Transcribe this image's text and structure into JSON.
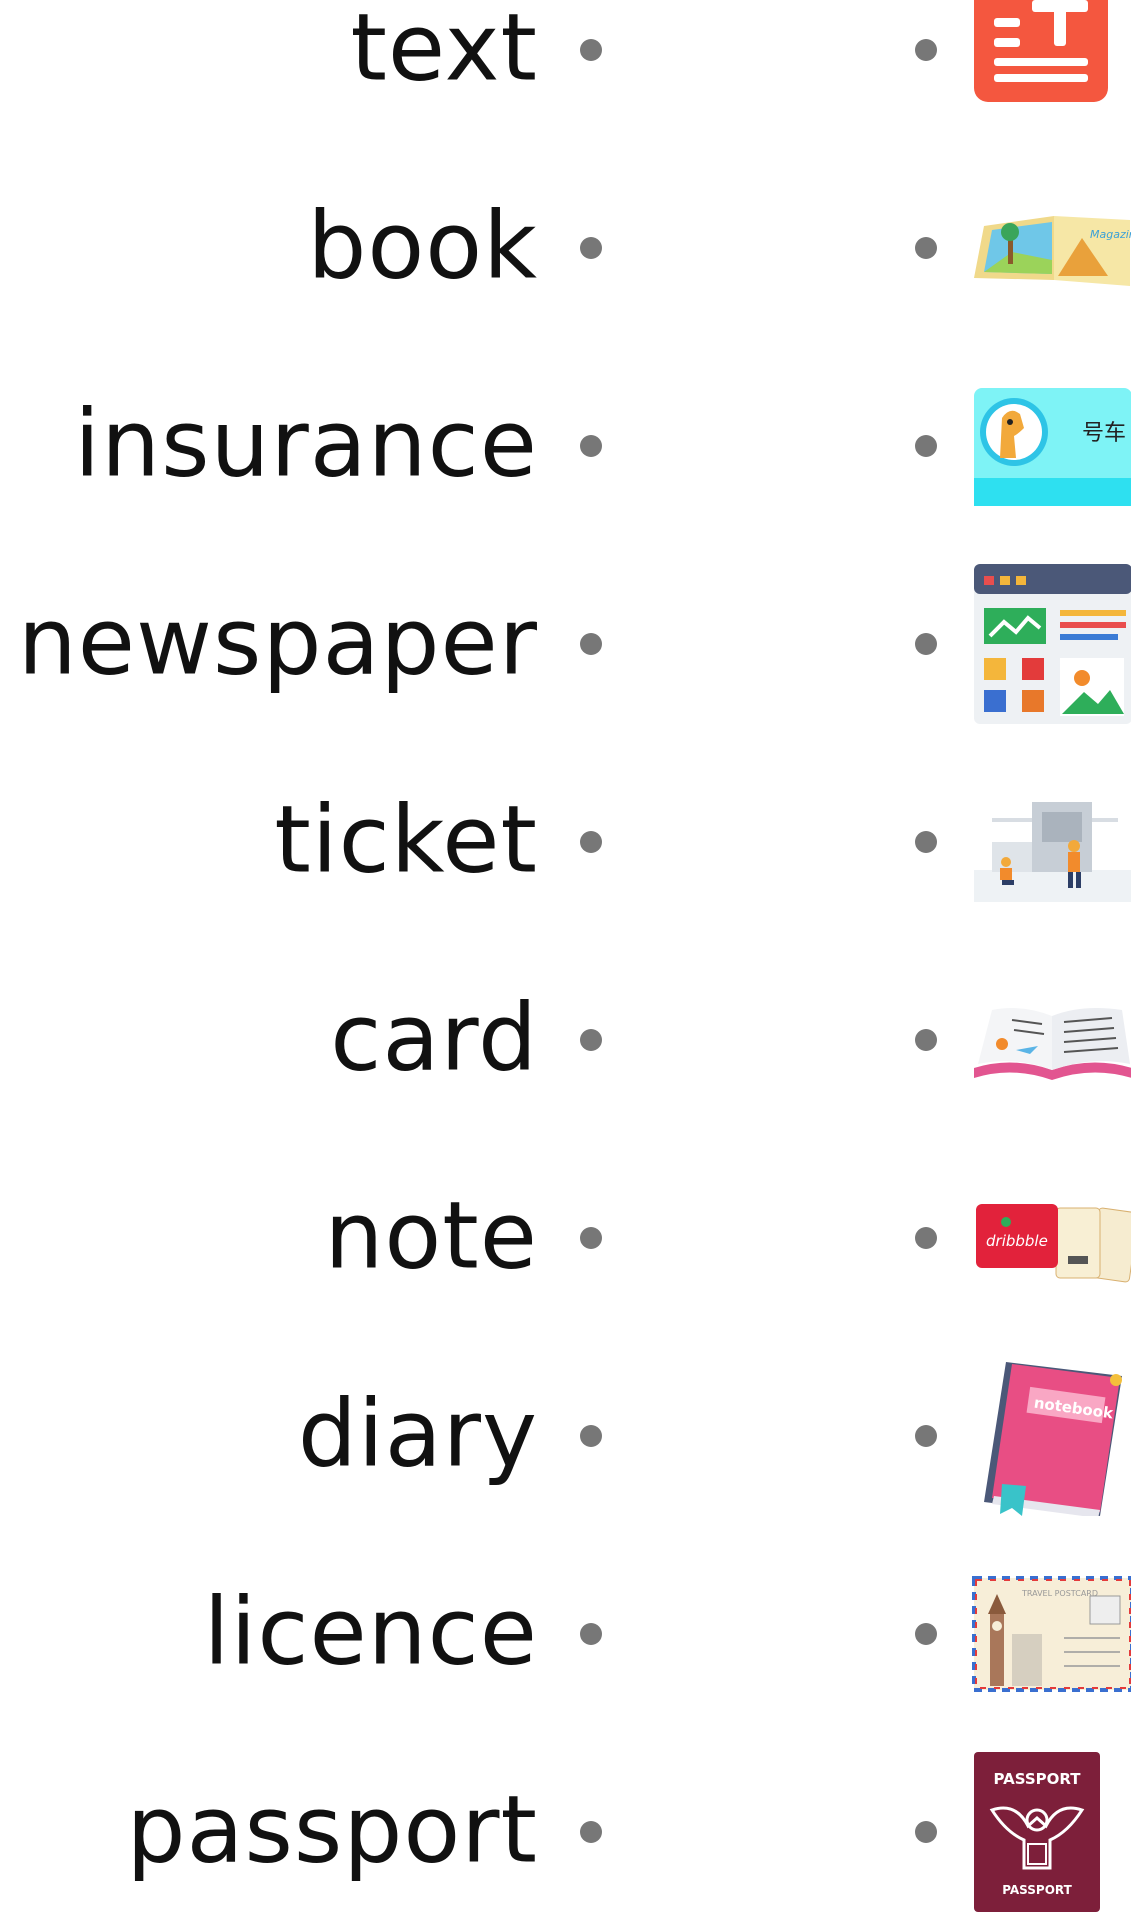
{
  "left_words": [
    "text",
    "book",
    "insurance",
    "newspaper",
    "ticket",
    "card",
    "note",
    "diary",
    "licence",
    "passport"
  ],
  "right_images": [
    {
      "icon": "text-icon",
      "color": "#f4573f"
    },
    {
      "icon": "magazine-icon",
      "label": "Magazine"
    },
    {
      "icon": "insurance-card-icon",
      "label": "号车",
      "color": "#5ef0f4"
    },
    {
      "icon": "newspaper-layout-icon"
    },
    {
      "icon": "construction-workers-icon"
    },
    {
      "icon": "open-book-icon"
    },
    {
      "icon": "tickets-icon",
      "label": "dribbble"
    },
    {
      "icon": "notebook-icon",
      "label": "notebook",
      "color": "#e84e84"
    },
    {
      "icon": "postcard-icon",
      "label": "TRAVEL POSTCARD"
    },
    {
      "icon": "passport-icon",
      "label": "PASSPORT",
      "color": "#7d1f3a"
    }
  ]
}
